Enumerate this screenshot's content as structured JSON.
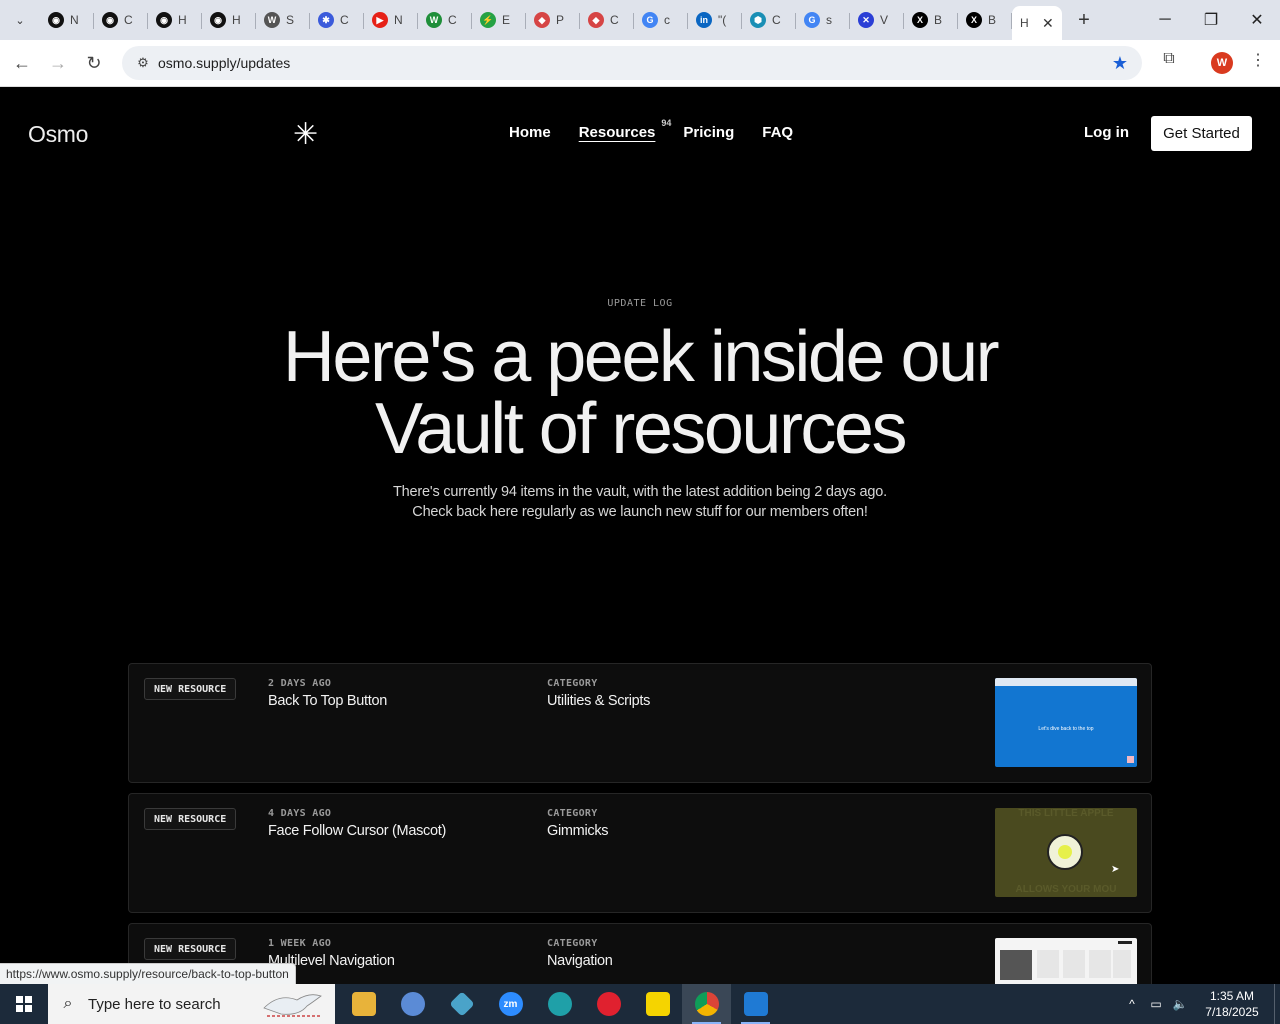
{
  "browser": {
    "tabs": [
      {
        "title": "N",
        "color": "#111111",
        "glyph": "◉"
      },
      {
        "title": "C",
        "color": "#111111",
        "glyph": "◉"
      },
      {
        "title": "H",
        "color": "#111111",
        "glyph": "◉"
      },
      {
        "title": "H",
        "color": "#111111",
        "glyph": "◉"
      },
      {
        "title": "S",
        "color": "#555555",
        "glyph": "W"
      },
      {
        "title": "C",
        "color": "#3b5bdb",
        "glyph": "✱"
      },
      {
        "title": "N",
        "color": "#e62117",
        "glyph": "▶"
      },
      {
        "title": "C",
        "color": "#1f8f3a",
        "glyph": "W"
      },
      {
        "title": "E",
        "color": "#25a244",
        "glyph": "⚡"
      },
      {
        "title": "P",
        "color": "#d64545",
        "glyph": "◆"
      },
      {
        "title": "C",
        "color": "#d64545",
        "glyph": "◆"
      },
      {
        "title": "c",
        "color": "#4285f4",
        "glyph": "G"
      },
      {
        "title": "\"(",
        "color": "#0a66c2",
        "glyph": "in"
      },
      {
        "title": "C",
        "color": "#1a8fb5",
        "glyph": "⬢"
      },
      {
        "title": "s",
        "color": "#4285f4",
        "glyph": "G"
      },
      {
        "title": "V",
        "color": "#2b3fd6",
        "glyph": "✕"
      },
      {
        "title": "B",
        "color": "#000000",
        "glyph": "X"
      },
      {
        "title": "B",
        "color": "#000000",
        "glyph": "X"
      }
    ],
    "active_tab": {
      "title": "H",
      "close": "✕"
    },
    "url": "osmo.supply/updates",
    "status_url": "https://www.osmo.supply/resource/back-to-top-button",
    "profile_initial": "W"
  },
  "site": {
    "logo": "Osmo",
    "mark": "✳",
    "nav": [
      {
        "label": "Home"
      },
      {
        "label": "Resources",
        "count": "94"
      },
      {
        "label": "Pricing"
      },
      {
        "label": "FAQ"
      }
    ],
    "login": "Log in",
    "cta": "Get Started"
  },
  "hero": {
    "eyebrow": "UPDATE LOG",
    "line1": "Here's a peek inside our",
    "line2": "Vault of resources",
    "sub1": "There's currently 94 items in the vault, with the latest addition being 2 days ago.",
    "sub2": "Check back here regularly as we launch new stuff for our members often!"
  },
  "updates": [
    {
      "badge": "NEW RESOURCE",
      "date": "2 DAYS AGO",
      "title": "Back To Top Button",
      "cat_label": "CATEGORY",
      "category": "Utilities & Scripts"
    },
    {
      "badge": "NEW RESOURCE",
      "date": "4 DAYS AGO",
      "title": "Face Follow Cursor (Mascot)",
      "cat_label": "CATEGORY",
      "category": "Gimmicks"
    },
    {
      "badge": "NEW RESOURCE",
      "date": "1 WEEK AGO",
      "title": "Multilevel Navigation",
      "cat_label": "CATEGORY",
      "category": "Navigation"
    }
  ],
  "thumb_text": {
    "t1": "Let's dive back to the top",
    "t2_top": "THIS LITTLE APPLE",
    "t2_bottom": "ALLOWS YOUR MOU"
  },
  "taskbar": {
    "search_placeholder": "Type here to search",
    "time": "1:35 AM",
    "date": "7/18/2025"
  }
}
